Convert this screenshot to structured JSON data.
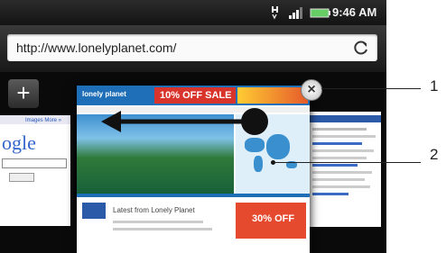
{
  "status_bar": {
    "time": "9:46 AM",
    "icons": [
      "h-plus-icon",
      "signal-icon",
      "battery-icon"
    ]
  },
  "browser": {
    "url": "http://www.lonelyplanet.com/",
    "add_tab_label": "+",
    "close_tab_label": "×"
  },
  "thumbnails": {
    "left": {
      "links": "Images More »",
      "logo_text": "ogle"
    },
    "center": {
      "brand": "lonely planet",
      "banner": "10% OFF SALE",
      "promo": "Latest from Lonely Planet",
      "price": "30% OFF"
    }
  },
  "callouts": [
    "1",
    "2"
  ],
  "colors": {
    "status_bar": "#1c1c1c",
    "url_bar": "#fafafa",
    "banner_red": "#d9342b",
    "lp_blue": "#1e6fb8"
  }
}
